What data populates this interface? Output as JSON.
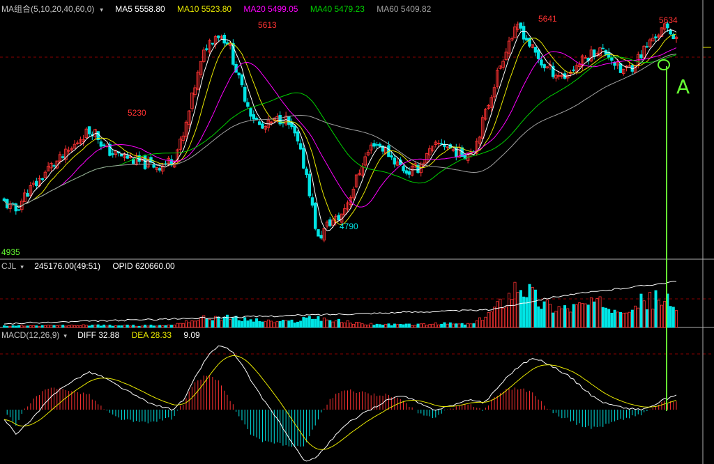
{
  "colors": {
    "up": "#ff3232",
    "down": "#00e5e5",
    "ma5": "#ffffff",
    "ma10": "#e8e800",
    "ma20": "#ff00ff",
    "ma40": "#00d000",
    "ma60": "#a0a0a0",
    "grid": "#8b0000",
    "annotation": "#66ff33",
    "text": "#c0c0c0"
  },
  "main": {
    "header_name": "MA组合(5,10,20,40,60,0)",
    "ma5_label": "MA5 5558.80",
    "ma10_label": "MA10 5523.80",
    "ma20_label": "MA20 5499.05",
    "ma40_label": "MA40 5479.23",
    "ma60_label": "MA60 5409.82",
    "annot_high1": "5230",
    "annot_high2": "5613",
    "annot_high3": "5641",
    "annot_high4": "5634",
    "annot_low1": "4790",
    "annot_low0": "4935",
    "handwritten_mark": "A"
  },
  "volume": {
    "header_name": "CJL",
    "value_label": "245176.00(49:51)",
    "opid_label": "OPID 620660.00"
  },
  "macd": {
    "header_name": "MACD(12,26,9)",
    "diff_label": "DIFF 32.88",
    "dea_label": "DEA 28.33",
    "macd_value": "9.09"
  },
  "chart_data": {
    "type": "candlestick",
    "price_range": [
      4720,
      5690
    ],
    "volume_max": 245176,
    "macd_range": [
      -75,
      100
    ],
    "price_path": [
      4940,
      4905,
      4980,
      5020,
      5080,
      5110,
      5150,
      5210,
      5230,
      5150,
      5130,
      5120,
      5100,
      5090,
      5085,
      5110,
      5200,
      5400,
      5560,
      5613,
      5580,
      5420,
      5300,
      5230,
      5260,
      5280,
      5200,
      5050,
      4790,
      4860,
      4880,
      4980,
      5100,
      5180,
      5150,
      5100,
      5060,
      5080,
      5140,
      5180,
      5150,
      5130,
      5160,
      5300,
      5450,
      5580,
      5641,
      5560,
      5490,
      5460,
      5440,
      5480,
      5520,
      5550,
      5530,
      5460,
      5480,
      5540,
      5600,
      5634,
      5600
    ],
    "volume_path": [
      0.03,
      0.03,
      0.04,
      0.03,
      0.04,
      0.04,
      0.04,
      0.05,
      0.05,
      0.04,
      0.04,
      0.04,
      0.04,
      0.04,
      0.04,
      0.05,
      0.12,
      0.16,
      0.2,
      0.22,
      0.2,
      0.18,
      0.16,
      0.14,
      0.12,
      0.12,
      0.14,
      0.2,
      0.22,
      0.16,
      0.13,
      0.1,
      0.08,
      0.07,
      0.06,
      0.06,
      0.06,
      0.06,
      0.07,
      0.08,
      0.08,
      0.07,
      0.08,
      0.25,
      0.45,
      0.7,
      1.0,
      0.75,
      0.5,
      0.45,
      0.42,
      0.45,
      0.5,
      0.5,
      0.48,
      0.45,
      0.5,
      0.55,
      0.6,
      0.62,
      0.3
    ],
    "diff_path": [
      -15,
      -35,
      -20,
      0,
      20,
      35,
      45,
      55,
      50,
      40,
      30,
      20,
      10,
      5,
      0,
      15,
      50,
      80,
      95,
      85,
      60,
      30,
      5,
      -20,
      -50,
      -75,
      -70,
      -50,
      -30,
      -15,
      -5,
      5,
      15,
      20,
      15,
      5,
      0,
      5,
      10,
      15,
      10,
      30,
      50,
      65,
      75,
      70,
      60,
      50,
      35,
      20,
      10,
      5,
      2,
      0,
      5,
      15,
      20
    ]
  }
}
